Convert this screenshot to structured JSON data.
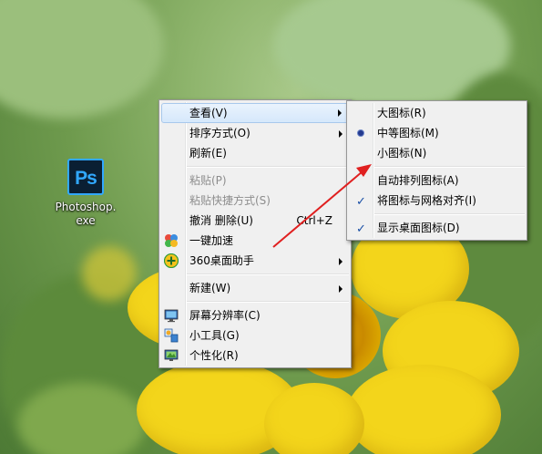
{
  "desktop": {
    "icon": {
      "logo_text": "Ps",
      "label_line1": "Photoshop.",
      "label_line2": "exe"
    }
  },
  "context_menu": {
    "items": [
      {
        "label": "查看(V)",
        "has_submenu": true,
        "highlighted": true
      },
      {
        "label": "排序方式(O)",
        "has_submenu": true
      },
      {
        "label": "刷新(E)"
      },
      {
        "label": "粘贴(P)",
        "disabled": true
      },
      {
        "label": "粘贴快捷方式(S)",
        "disabled": true
      },
      {
        "label": "撤消 删除(U)",
        "shortcut": "Ctrl+Z"
      },
      {
        "label": "一键加速",
        "icon": "speedup-icon"
      },
      {
        "label": "360桌面助手",
        "icon": "360-assistant-icon",
        "has_submenu": true
      },
      {
        "label": "新建(W)",
        "has_submenu": true
      },
      {
        "label": "屏幕分辨率(C)",
        "icon": "monitor-icon"
      },
      {
        "label": "小工具(G)",
        "icon": "gadgets-icon"
      },
      {
        "label": "个性化(R)",
        "icon": "personalize-icon"
      }
    ]
  },
  "view_submenu": {
    "items": [
      {
        "label": "大图标(R)"
      },
      {
        "label": "中等图标(M)",
        "selected": true
      },
      {
        "label": "小图标(N)"
      },
      {
        "label": "自动排列图标(A)"
      },
      {
        "label": "将图标与网格对齐(I)",
        "checked": true
      },
      {
        "label": "显示桌面图标(D)",
        "checked": true
      }
    ]
  },
  "annotation": {
    "color": "#e02020",
    "type": "red-arrow",
    "from": "context-menu",
    "to": "小图标(N)"
  }
}
